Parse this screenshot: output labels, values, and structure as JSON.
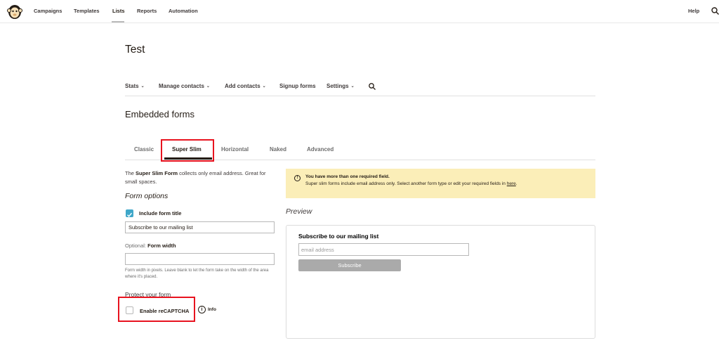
{
  "topnav": {
    "items": [
      "Campaigns",
      "Templates",
      "Lists",
      "Reports",
      "Automation"
    ],
    "active": "Lists",
    "help": "Help",
    "search_icon": "search-icon",
    "logo": "mailchimp-logo"
  },
  "page": {
    "title": "Test"
  },
  "subnav": {
    "items": [
      {
        "label": "Stats",
        "dropdown": true
      },
      {
        "label": "Manage contacts",
        "dropdown": true
      },
      {
        "label": "Add contacts",
        "dropdown": true
      },
      {
        "label": "Signup forms",
        "dropdown": false
      },
      {
        "label": "Settings",
        "dropdown": true
      }
    ],
    "chevron": "⌄",
    "search_icon": "search-icon"
  },
  "section": {
    "title": "Embedded forms"
  },
  "tabs": {
    "items": [
      "Classic",
      "Super Slim",
      "Horizontal",
      "Naked",
      "Advanced"
    ],
    "active": "Super Slim"
  },
  "left": {
    "desc_pre": "The ",
    "desc_bold": "Super Slim Form",
    "desc_post": " collects only email address. Great for small spaces.",
    "form_options": "Form options",
    "include_title_label": "Include form title",
    "include_title_checked": true,
    "title_value": "Subscribe to our mailing list",
    "optional_prefix": "Optional: ",
    "optional_label": "Form width",
    "width_value": "",
    "width_help": "Form width in pixels. Leave blank to let the form take on the width of the area where it's placed.",
    "protect_title": "Protect your form",
    "recaptcha_label": "Enable reCAPTCHA",
    "recaptcha_checked": false,
    "info_glyph": "i",
    "info_label": "Info"
  },
  "warning": {
    "icon_glyph": "!",
    "title": "You have more than one required field.",
    "body": "Super slim forms include email address only. Select another form type or edit your required fields in",
    "link": "here",
    "after_link": "."
  },
  "preview": {
    "label": "Preview",
    "heading": "Subscribe to our mailing list",
    "email_placeholder": "email address",
    "button": "Subscribe"
  },
  "colors": {
    "accent_teal": "#3fa7c9",
    "warning_bg": "#fbeeb8",
    "highlight_red": "#e8131f",
    "preview_button": "#aaaaaa"
  }
}
